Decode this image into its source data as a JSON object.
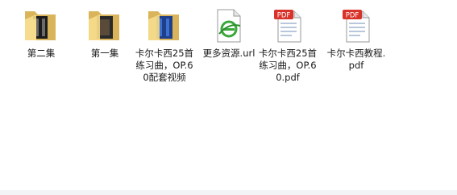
{
  "files": [
    {
      "label": "第二集",
      "type": "folder",
      "icon": "folder-dark-icon"
    },
    {
      "label": "第一集",
      "type": "folder",
      "icon": "folder-dark-icon"
    },
    {
      "label": "卡尔卡西25首练习曲，OP.60配套视频",
      "type": "folder",
      "icon": "folder-video-icon"
    },
    {
      "label": "更多资源.url",
      "type": "url",
      "icon": "internet-shortcut-icon"
    },
    {
      "label": "卡尔卡西25首练习曲，OP.60.pdf",
      "type": "pdf",
      "icon": "pdf-file-icon",
      "badge": "PDF"
    },
    {
      "label": "卡尔卡西教程.pdf",
      "type": "pdf",
      "icon": "pdf-file-icon",
      "badge": "PDF"
    }
  ],
  "colors": {
    "folder_tab": "#e8c46b",
    "folder_front": "#f6dc8d",
    "pdf_badge": "#d9322a",
    "ie_green": "#3aa83a"
  }
}
